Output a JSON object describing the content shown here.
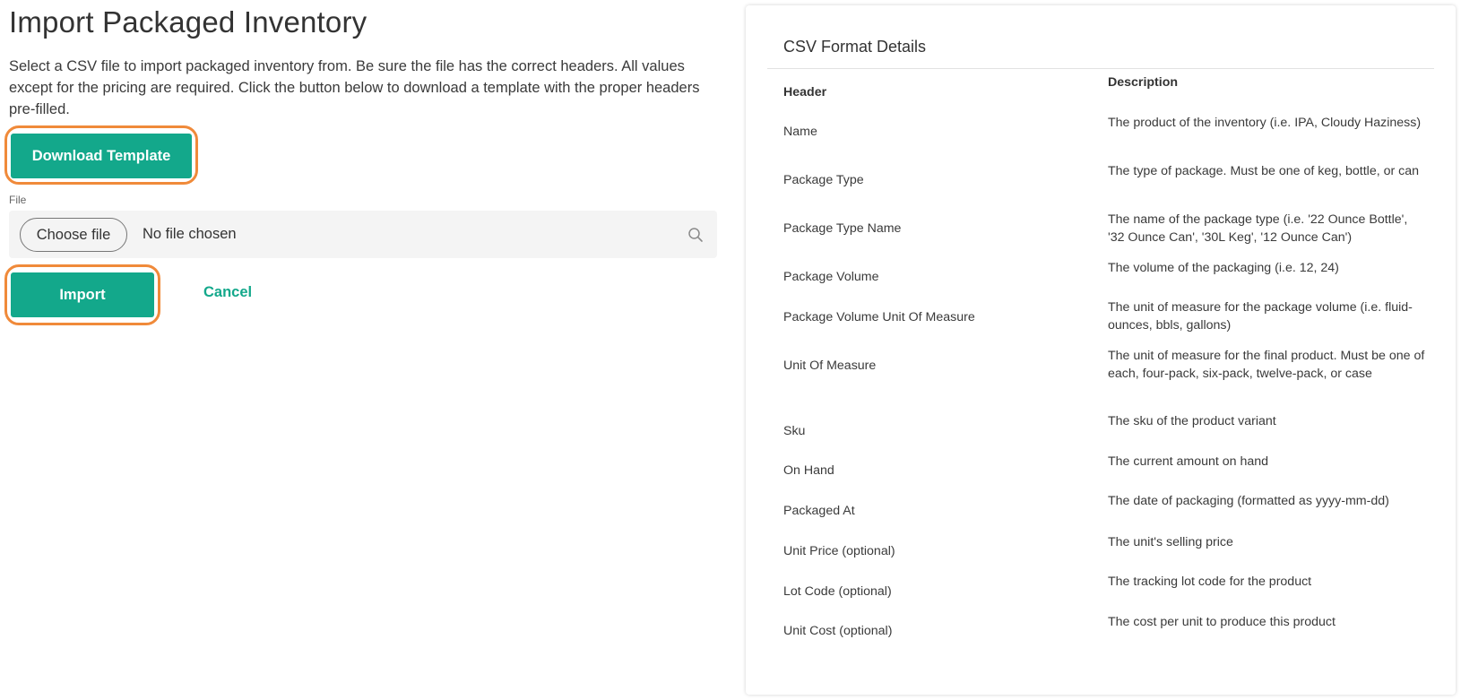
{
  "page": {
    "title": "Import Packaged Inventory",
    "intro": "Select a CSV file to import packaged inventory from. Be sure the file has the correct headers. All values except for the pricing are required. Click the button below to download a template with the proper headers pre-filled."
  },
  "actions": {
    "download_label": "Download Template",
    "import_label": "Import",
    "cancel_label": "Cancel"
  },
  "file": {
    "label": "File",
    "choose_label": "Choose file",
    "status": "No file chosen",
    "icon": "search-icon"
  },
  "colors": {
    "accent": "#13a88b",
    "highlight": "#f08a3a"
  },
  "csv": {
    "title": "CSV Format Details",
    "header_col": "Header",
    "description_col": "Description",
    "rows": [
      {
        "header": "Name",
        "description": "The product of the inventory (i.e. IPA, Cloudy Haziness)"
      },
      {
        "header": "Package Type",
        "description": "The type of package. Must be one of keg, bottle, or can"
      },
      {
        "header": "Package Type Name",
        "description": "The name of the package type (i.e. '22 Ounce Bottle', '32 Ounce Can', '30L Keg', '12 Ounce Can')"
      },
      {
        "header": "Package Volume",
        "description": "The volume of the packaging (i.e. 12, 24)"
      },
      {
        "header": "Package Volume Unit Of Measure",
        "description": "The unit of measure for the package volume (i.e. fluid-ounces, bbls, gallons)"
      },
      {
        "header": "Unit Of Measure",
        "description": "The unit of measure for the final product. Must be one of each, four-pack, six-pack, twelve-pack, or case"
      },
      {
        "header": "Sku",
        "description": "The sku of the product variant"
      },
      {
        "header": "On Hand",
        "description": "The current amount on hand"
      },
      {
        "header": "Packaged At",
        "description": "The date of packaging (formatted as yyyy-mm-dd)"
      },
      {
        "header": "Unit Price (optional)",
        "description": "The unit's selling price"
      },
      {
        "header": "Lot Code (optional)",
        "description": "The tracking lot code for the product"
      },
      {
        "header": "Unit Cost (optional)",
        "description": "The cost per unit to produce this product"
      }
    ]
  }
}
